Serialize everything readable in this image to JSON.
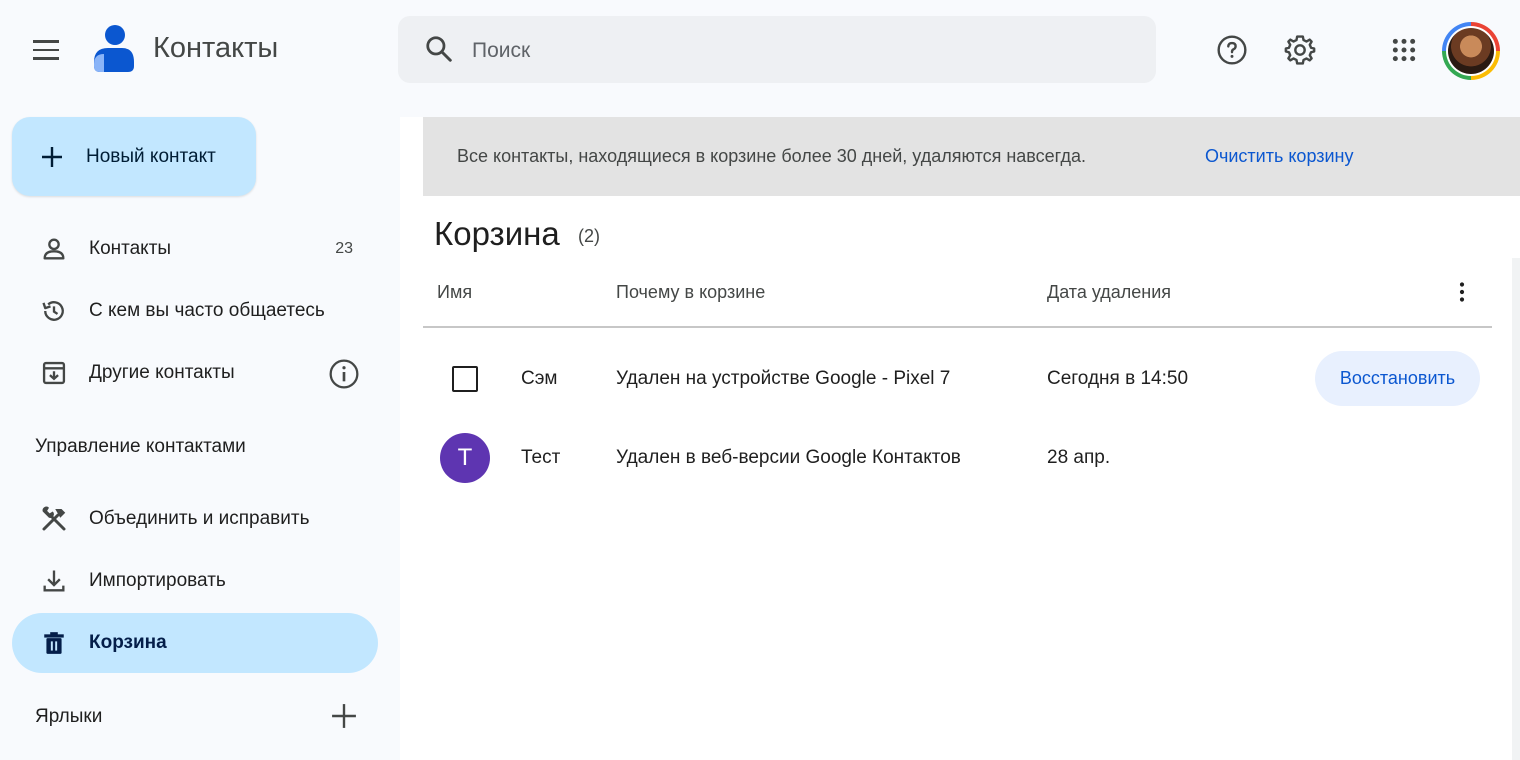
{
  "header": {
    "app_title": "Контакты",
    "search_placeholder": "Поиск",
    "icons": [
      "menu-icon",
      "contacts-logo-icon",
      "search-icon",
      "help-icon",
      "settings-icon",
      "apps-grid-icon",
      "account-avatar"
    ]
  },
  "sidebar": {
    "new_contact_label": "Новый контакт",
    "items": [
      {
        "label": "Контакты",
        "count": "23",
        "icon": "person-icon"
      },
      {
        "label": "С кем вы часто общаетесь",
        "icon": "history-icon"
      },
      {
        "label": "Другие контакты",
        "icon": "archive-download-icon"
      }
    ],
    "manage_title": "Управление контактами",
    "manage_items": [
      {
        "label": "Объединить и исправить",
        "icon": "tools-icon"
      },
      {
        "label": "Импортировать",
        "icon": "download-icon"
      },
      {
        "label": "Корзина",
        "icon": "trash-icon",
        "active": true
      }
    ],
    "labels_title": "Ярлыки"
  },
  "banner": {
    "text": "Все контакты, находящиеся в корзине более 30 дней, удаляются навсегда.",
    "link": "Очистить корзину"
  },
  "trash": {
    "title": "Корзина",
    "count": "(2)",
    "columns": [
      "Имя",
      "Почему в корзине",
      "Дата удаления"
    ],
    "rows": [
      {
        "name": "Сэм",
        "reason": "Удален на устройстве Google - Pixel 7",
        "date": "Сегодня в 14:50",
        "action": "Восстановить"
      },
      {
        "name": "Тест",
        "avatar_letter": "T",
        "reason": "Удален в веб-версии Google Контактов",
        "date": "28 апр."
      }
    ]
  },
  "colors": {
    "accent": "#0b57d0",
    "active_bg": "#c2e7ff",
    "avatar_purple": "#5e35b1",
    "banner_bg": "#e3e3e3"
  }
}
